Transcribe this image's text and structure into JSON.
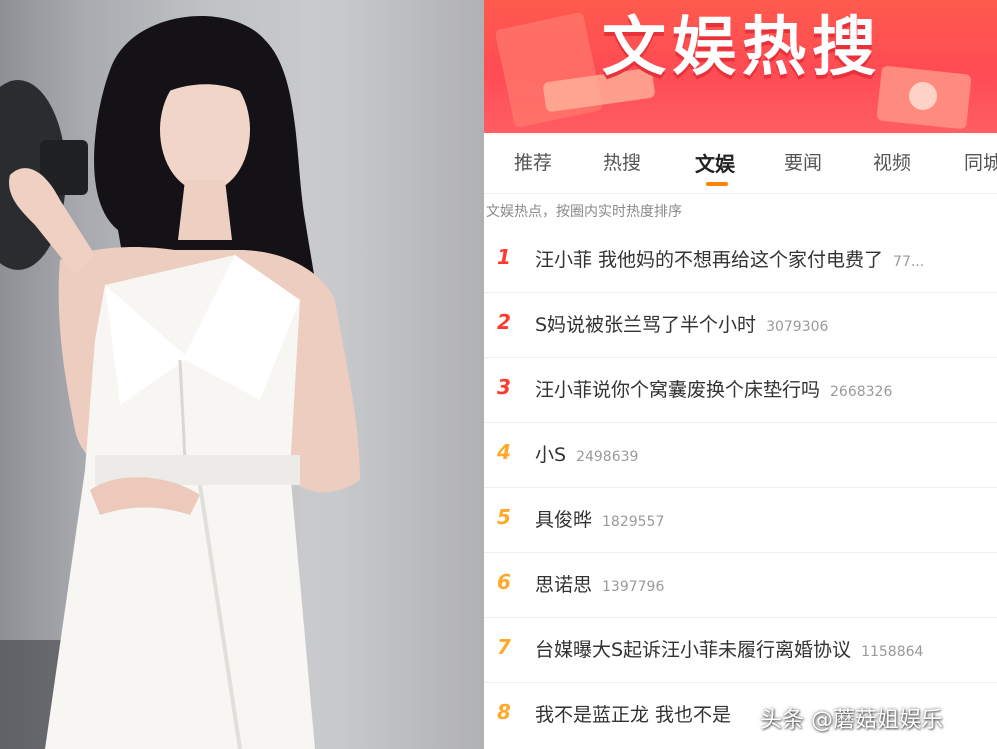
{
  "banner": {
    "title": "文娱热搜"
  },
  "tabs": [
    {
      "label": "推荐",
      "active": false
    },
    {
      "label": "热搜",
      "active": false
    },
    {
      "label": "文娱",
      "active": true
    },
    {
      "label": "要闻",
      "active": false
    },
    {
      "label": "视频",
      "active": false
    },
    {
      "label": "同城",
      "active": false
    }
  ],
  "subtitle": "文娱热点，按圈内实时热度排序",
  "hot_list": [
    {
      "rank": "1",
      "topic": "汪小菲 我他妈的不想再给这个家付电费了",
      "heat": "77..."
    },
    {
      "rank": "2",
      "topic": "S妈说被张兰骂了半个小时",
      "heat": "3079306"
    },
    {
      "rank": "3",
      "topic": "汪小菲说你个窝囊废换个床垫行吗",
      "heat": "2668326"
    },
    {
      "rank": "4",
      "topic": "小S",
      "heat": "2498639"
    },
    {
      "rank": "5",
      "topic": "具俊晔",
      "heat": "1829557"
    },
    {
      "rank": "6",
      "topic": "思诺思",
      "heat": "1397796"
    },
    {
      "rank": "7",
      "topic": "台媒曝大S起诉汪小菲未履行离婚协议",
      "heat": "1158864"
    },
    {
      "rank": "8",
      "topic": "我不是蓝正龙 我也不是",
      "heat": ""
    }
  ],
  "colors": {
    "rank_top3": "#ff3b30",
    "rank_rest": "#ffa92a",
    "tab_accent": "#ff8200",
    "banner_red": "#ff4b54"
  },
  "watermark": "头条 @蘑菇姐娱乐"
}
